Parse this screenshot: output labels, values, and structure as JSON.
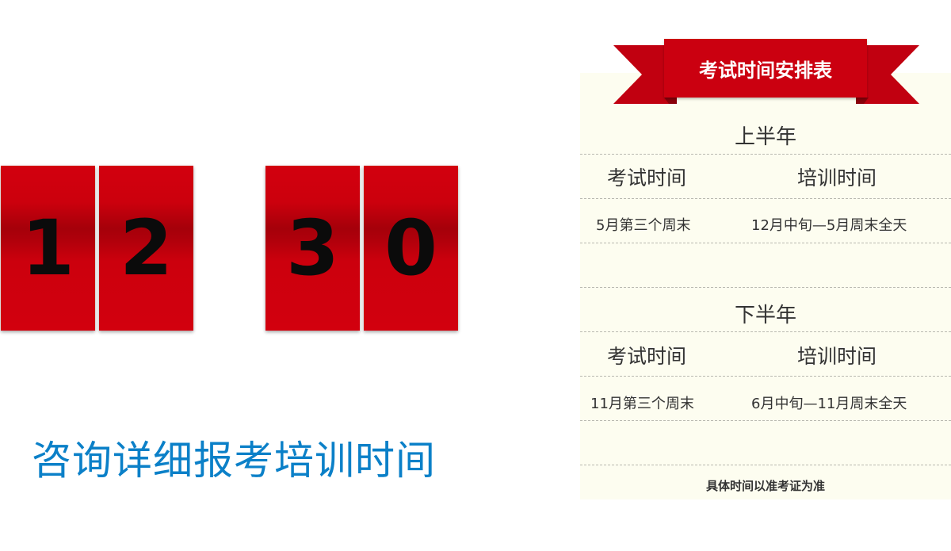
{
  "countdown": {
    "digits": [
      "1",
      "2",
      "3",
      "0"
    ]
  },
  "consult_text": "咨询详细报考培训时间",
  "schedule": {
    "title": "考试时间安排表",
    "first_half": {
      "title": "上半年",
      "headers": [
        "考试时间",
        "培训时间"
      ],
      "exam": "5月第三个周末",
      "training": "12月中旬—5月周末全天"
    },
    "second_half": {
      "title": "下半年",
      "headers": [
        "考试时间",
        "培训时间"
      ],
      "exam": "11月第三个周末",
      "training": "6月中旬—11月周末全天"
    },
    "note": "具体时间以准考证为准"
  },
  "colors": {
    "digit_red": "#d2000e",
    "ribbon_red": "#cb0010",
    "consult_blue": "#0b80c8",
    "panel_bg": "#fdfdf0"
  }
}
